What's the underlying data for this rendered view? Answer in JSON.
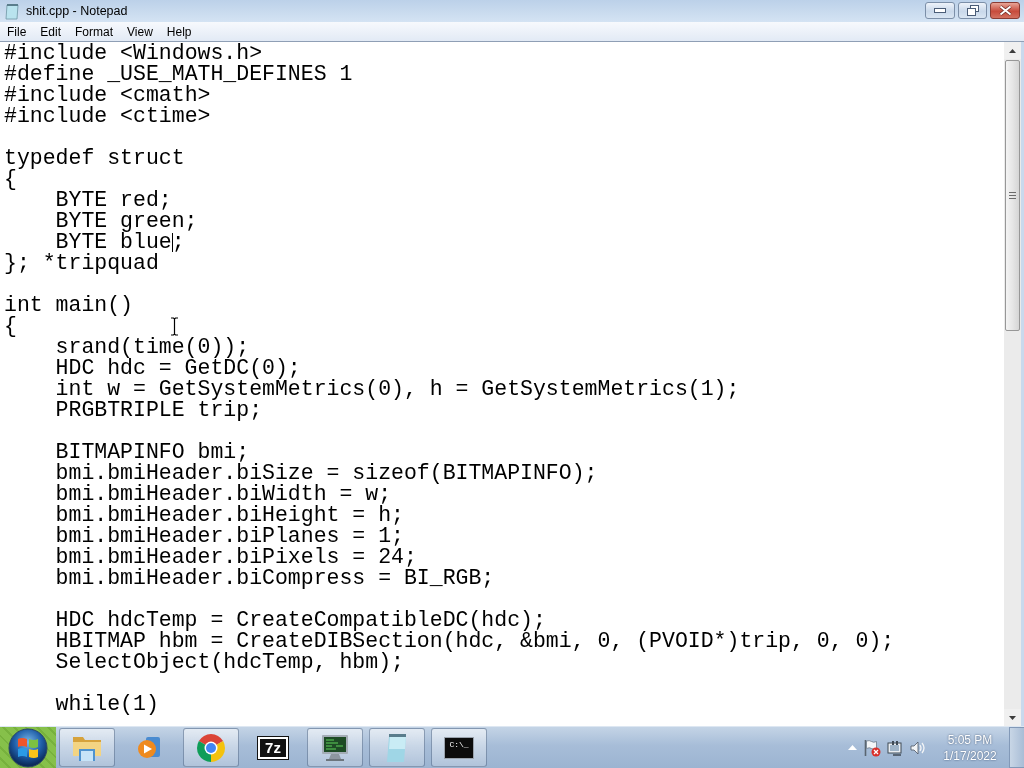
{
  "window": {
    "title": "shit.cpp - Notepad",
    "controls": [
      {
        "kind": "minimize"
      },
      {
        "kind": "restore"
      },
      {
        "kind": "close"
      }
    ]
  },
  "menu": [
    "File",
    "Edit",
    "Format",
    "View",
    "Help"
  ],
  "editor": {
    "blocks": [
      [
        "#include <Windows.h>",
        "#define _USE_MATH_DEFINES 1",
        "#include <cmath>",
        "#include <ctime>"
      ],
      [
        "typedef struct",
        "{",
        "    BYTE red;",
        "    BYTE green;",
        "    BYTE blue;",
        "}; *tripquad"
      ],
      [
        "int main()",
        "{",
        "    srand(time(0));",
        "    HDC hdc = GetDC(0);",
        "    int w = GetSystemMetrics(0), h = GetSystemMetrics(1);",
        "    PRGBTRIPLE trip;"
      ],
      [
        "    BITMAPINFO bmi;",
        "    bmi.bmiHeader.biSize = sizeof(BITMAPINFO);",
        "    bmi.bmiHeader.biWidth = w;",
        "    bmi.bmiHeader.biHeight = h;",
        "    bmi.bmiHeader.biPlanes = 1;",
        "    bmi.bmiHeader.biPixels = 24;",
        "    bmi.bmiHeader.biCompress = BI_RGB;"
      ],
      [
        "    HDC hdcTemp = CreateCompatibleDC(hdc);",
        "    HBITMAP hbm = CreateDIBSection(hdc, &bmi, 0, (PVOID*)trip, 0, 0);",
        "    SelectObject(hdcTemp, hbm);"
      ],
      [
        "    while(1)"
      ]
    ]
  },
  "taskbar": {
    "items": [
      {
        "kind": "folder",
        "running": true
      },
      {
        "kind": "player",
        "running": false
      },
      {
        "kind": "browser",
        "running": true
      },
      {
        "kind": "archiver",
        "running": false,
        "label": "7z"
      },
      {
        "kind": "monitor",
        "running": true
      },
      {
        "kind": "notepad",
        "running": true
      },
      {
        "kind": "console",
        "running": true,
        "label": "C:\\_"
      }
    ],
    "tray": [
      {
        "kind": "arrow"
      },
      {
        "kind": "flag"
      },
      {
        "kind": "network"
      },
      {
        "kind": "volume"
      }
    ],
    "clock": {
      "time": "5:05 PM",
      "date": "1/17/2022"
    }
  }
}
